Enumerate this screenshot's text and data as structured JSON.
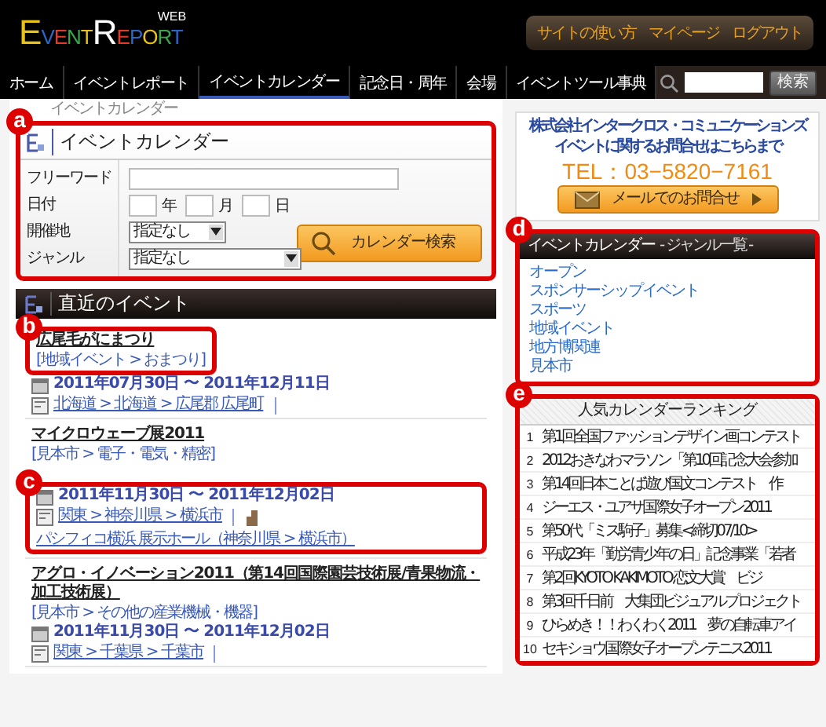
{
  "header": {
    "logo": {
      "word_1": "EVENT",
      "word_2": "REPORT",
      "tag": "WEB"
    },
    "links": [
      "サイトの使い方",
      "マイページ",
      "ログアウト"
    ]
  },
  "nav": {
    "items": [
      {
        "label": "ホーム",
        "selected": false
      },
      {
        "label": "イベントレポート",
        "selected": false
      },
      {
        "label": "イベントカレンダー",
        "selected": true
      },
      {
        "label": "記念日・周年",
        "selected": false
      },
      {
        "label": "会場",
        "selected": false
      },
      {
        "label": "イベントツール事典",
        "selected": false
      }
    ],
    "search_button": "検索"
  },
  "breadcrumb": "イベントカレンダー",
  "search_panel": {
    "marker": "a",
    "title": "イベントカレンダー",
    "freeword_label": "フリーワード",
    "date_label": "日付",
    "year": "年",
    "month": "月",
    "day": "日",
    "place_label": "開催地",
    "place_value": "指定なし",
    "genre_label": "ジャンル",
    "genre_value": "指定なし",
    "button": "カレンダー検索"
  },
  "recent": {
    "title": "直近のイベント",
    "events": [
      {
        "title": "広尾毛がにまつり",
        "category": "[地域イベント > おまつり]",
        "dates": "2011年07月30日 〜 2011年12月11日",
        "location": "北海道 > 北海道 > 広尾郡 広尾町",
        "head_marker": "b"
      },
      {
        "title": "マイクロウェーブ展2011",
        "category": "[見本市 > 電子・電気・精密]",
        "dates": "2011年11月30日 〜 2011年12月02日",
        "location": "関東 > 神奈川県 > 横浜市",
        "venue": "パシフィコ横浜 展示ホール（神奈川県 > 横浜市）",
        "body_marker": "c"
      },
      {
        "title": "アグロ・イノベーション2011（第14回国際園芸技術展/青果物流・加工技術展）",
        "category": "[見本市 > その他の産業機械・機器]",
        "dates": "2011年11月30日 〜 2011年12月02日",
        "location": "関東 > 千葉県 > 千葉市"
      }
    ]
  },
  "contact": {
    "company": "株式会社インタークロス・コミュニケーションズ",
    "note": "イベントに関するお問合せはこちらまで",
    "tel": "TEL：03−5820−7161",
    "button": "メールでのお問合せ"
  },
  "genres": {
    "marker": "d",
    "title": "イベントカレンダー",
    "subtitle": "- ジャンル一覧 -",
    "items": [
      "オープン",
      "スポンサーシップイベント",
      "スポーツ",
      "地域イベント",
      "地方博関連",
      "見本市"
    ]
  },
  "ranking": {
    "marker": "e",
    "title": "人気カレンダーランキング",
    "items": [
      {
        "rank": "1",
        "title": "第1回全国ファッションデザイン画コンテスト"
      },
      {
        "rank": "2",
        "title": "2012おきなわマラソン「第10回記念大会参加"
      },
      {
        "rank": "3",
        "title": "第14回日本ことば遊び国文コンテスト　作"
      },
      {
        "rank": "4",
        "title": "ジーエス・ユアサ国際女子オープン2011"
      },
      {
        "rank": "5",
        "title": "第50代「ミス駒子」募集<締切07/10>"
      },
      {
        "rank": "6",
        "title": "平成23年「勤労青少年の日」記念事業「若者"
      },
      {
        "rank": "7",
        "title": "第2回KYOTO KAKIMOTO 恋文大賞　ビジ"
      },
      {
        "rank": "8",
        "title": "第3回千日前　大集団ビジュアルプロジェクト"
      },
      {
        "rank": "9",
        "title": "ひらめき！！わくわく2011　夢の自転車アイ"
      },
      {
        "rank": "10",
        "title": "セキショウ国際女子オープンテニス2011"
      }
    ]
  }
}
